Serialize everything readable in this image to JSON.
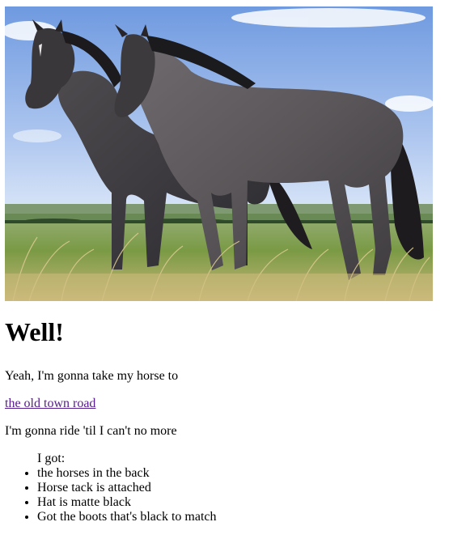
{
  "image": {
    "alt": "Two horses standing in a grassy field"
  },
  "content": {
    "heading": "Well!",
    "line1": "Yeah, I'm gonna take my horse to",
    "link_text": "the old town road",
    "line3": "I'm gonna ride 'til I can't no more",
    "list_intro": "I got:",
    "items": [
      "the horses in the back",
      "Horse tack is attached",
      "Hat is matte black",
      "Got the boots that's black to match"
    ]
  },
  "colors": {
    "link_visited": "#551a8b",
    "text": "#000000",
    "background": "#ffffff"
  }
}
